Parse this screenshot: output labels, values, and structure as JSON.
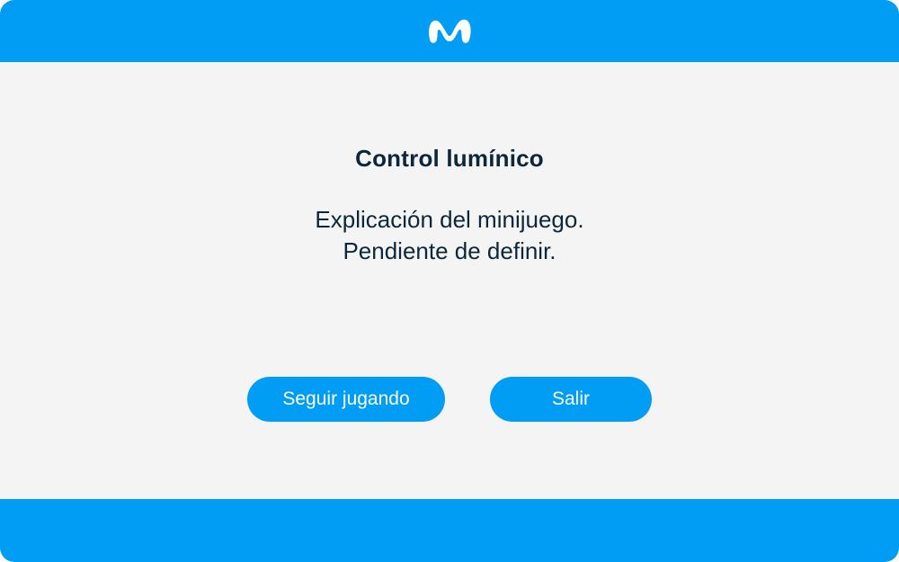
{
  "header": {
    "logo_icon": "movistar-m-logo-icon",
    "brand_color": "#019df4"
  },
  "dialog": {
    "title": "Control lumínico",
    "description_line1": "Explicación del minijuego.",
    "description_line2": "Pendiente de definir."
  },
  "buttons": {
    "continue_label": "Seguir jugando",
    "exit_label": "Salir"
  },
  "colors": {
    "accent": "#019df4",
    "background": "#f4f4f4",
    "text": "#0b2739",
    "button_text": "#ffffff"
  }
}
